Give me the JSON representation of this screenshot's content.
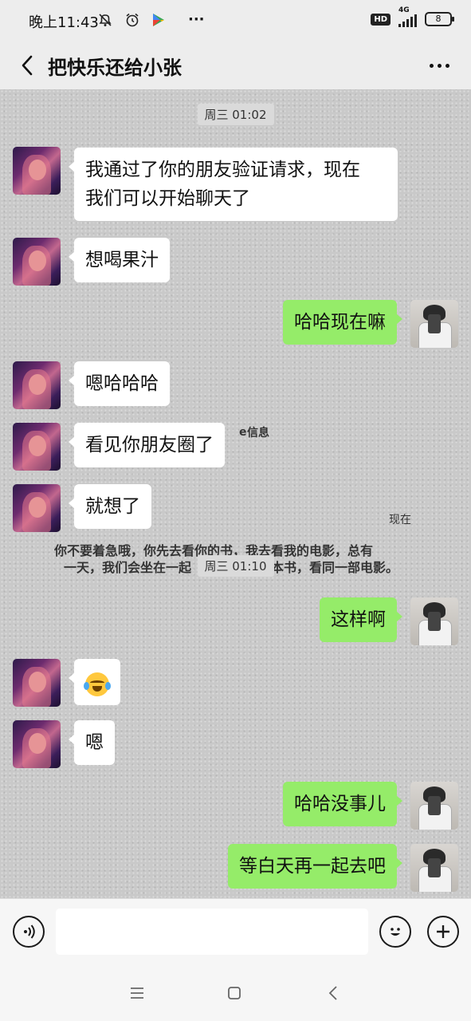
{
  "status_bar": {
    "time": "晚上11:43",
    "network": "4G",
    "battery": "8",
    "more": "···"
  },
  "header": {
    "title": "把快乐还给小张",
    "back_icon": "chevron-left-icon",
    "more_icon": "more-dots-icon"
  },
  "background_text": {
    "label_info": "信息",
    "label_now": "现在",
    "line1": "你不要着急哦，你先去看你的书，我去看我的电影，总有",
    "line2": "一天，我们会坐在一起",
    "line2_tail": "本书，看同一部电影。",
    "fragment_e": "e"
  },
  "timestamps": [
    "周三 01:02",
    "周三 01:10"
  ],
  "messages": [
    {
      "side": "in",
      "text": "我通过了你的朋友验证请求，现在"
    },
    {
      "side": "in",
      "text": "我们可以开始聊天了"
    },
    {
      "side": "in",
      "text": "想喝果汁"
    },
    {
      "side": "out",
      "text": "哈哈现在嘛"
    },
    {
      "side": "in",
      "text": "嗯哈哈哈"
    },
    {
      "side": "in",
      "text": "看见你朋友圈了"
    },
    {
      "side": "in",
      "text": "就想了"
    },
    {
      "side": "out",
      "text": "这样啊"
    },
    {
      "side": "in",
      "text": "",
      "emoji": "crying-laughing-emoji"
    },
    {
      "side": "in",
      "text": "嗯"
    },
    {
      "side": "out",
      "text": "哈哈没事儿"
    },
    {
      "side": "out",
      "text": "等白天再一起去吧"
    }
  ],
  "input": {
    "placeholder": "",
    "voice_icon": "voice-icon",
    "emoji_icon": "smiley-icon",
    "add_icon": "plus-icon"
  },
  "colors": {
    "incoming_bubble": "#ffffff",
    "outgoing_bubble": "#95ec69",
    "header_bg": "#ededed"
  }
}
